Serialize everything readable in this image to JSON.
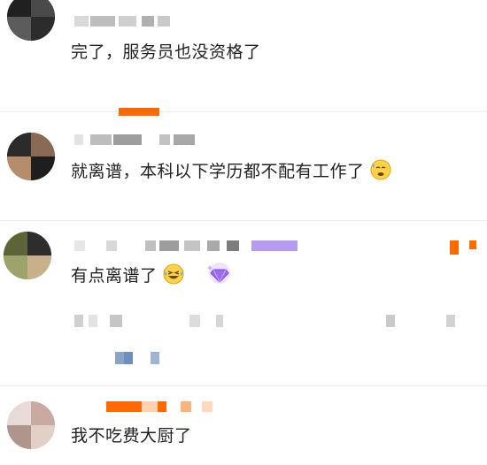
{
  "comments": [
    {
      "text": "完了，服务员也没资格了"
    },
    {
      "text": "就离谱，本科以下学历都不配有工作了"
    },
    {
      "text": "有点离谱了"
    },
    {
      "text": "我不吃费大厨了"
    }
  ],
  "icons": {
    "emoji_sweat": "sweat-emoji-icon",
    "emoji_laugh": "laugh-cry-emoji-icon",
    "badge": "purple-gem-badge-icon"
  },
  "colors": {
    "accent_orange": "#ff6a00",
    "badge_purple": "#9b6cf2",
    "text": "#222222",
    "mosaic": "#c8c8c8"
  }
}
